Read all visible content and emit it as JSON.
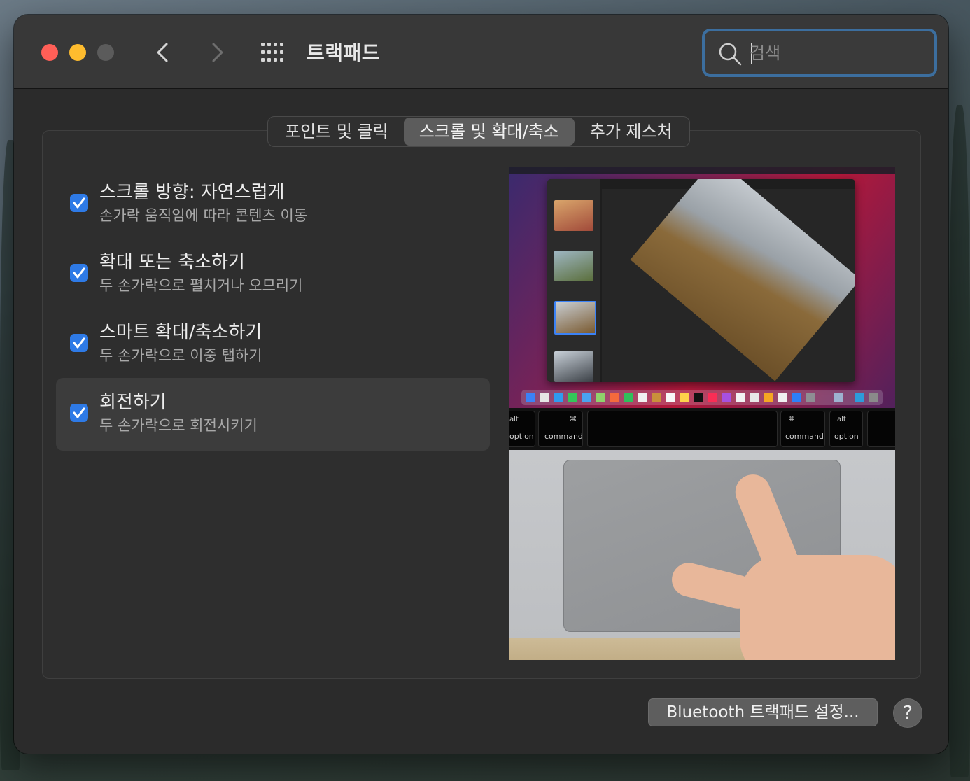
{
  "window": {
    "title": "트랙패드"
  },
  "search": {
    "placeholder": "검색",
    "value": ""
  },
  "tabs": [
    {
      "label": "포인트 및 클릭",
      "active": false
    },
    {
      "label": "스크롤 및 확대/축소",
      "active": true
    },
    {
      "label": "추가 제스처",
      "active": false
    }
  ],
  "options": [
    {
      "title": "스크롤 방향: 자연스럽게",
      "subtitle": "손가락 움직임에 따라 콘텐츠 이동",
      "checked": true,
      "selected": false
    },
    {
      "title": "확대 또는 축소하기",
      "subtitle": "두 손가락으로 펼치거나 오므리기",
      "checked": true,
      "selected": false
    },
    {
      "title": "스마트 확대/축소하기",
      "subtitle": "두 손가락으로 이중 탭하기",
      "checked": true,
      "selected": false
    },
    {
      "title": "회전하기",
      "subtitle": "두 손가락으로 회전시키기",
      "checked": true,
      "selected": true
    }
  ],
  "preview": {
    "keys": [
      {
        "top": "alt",
        "bottom": "option"
      },
      {
        "top": "⌘",
        "bottom": "command"
      },
      {
        "top": "⌘",
        "bottom": "command"
      },
      {
        "top": "alt",
        "bottom": "option"
      }
    ]
  },
  "footer": {
    "bluetooth_label": "Bluetooth 트랙패드 설정...",
    "help_label": "?"
  },
  "colors": {
    "accent": "#2e7ae6",
    "focus_ring": "#3c6e9e",
    "close": "#ff5f57",
    "minimize": "#febc2e"
  }
}
